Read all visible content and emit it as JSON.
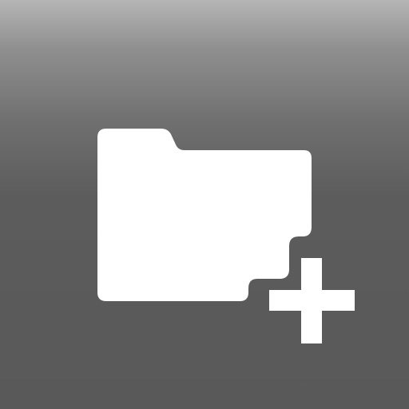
{
  "icon": {
    "name": "new-folder-icon",
    "parts": [
      "folder-icon",
      "plus-icon"
    ],
    "colors": {
      "glyph": "#ffffff",
      "background_top": "#b5b5b5",
      "background_bottom": "#595959"
    }
  }
}
